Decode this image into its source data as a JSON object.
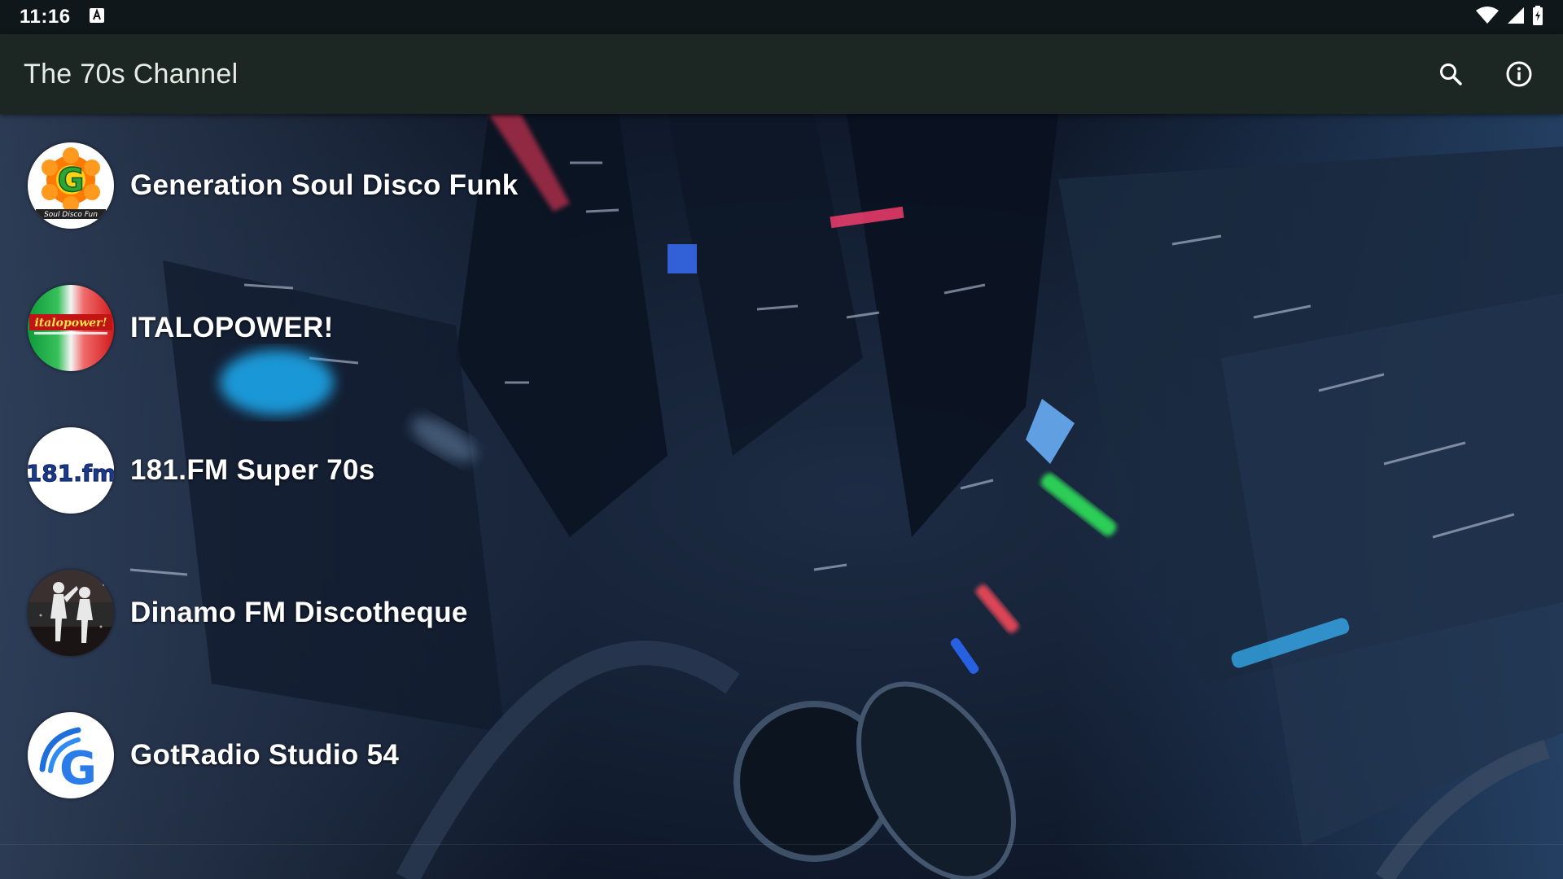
{
  "status_bar": {
    "time": "11:16",
    "notification_icon": "keyboard-a-icon",
    "icons": [
      "wifi-icon",
      "cell-signal-icon",
      "battery-icon"
    ]
  },
  "app_bar": {
    "title": "The 70s Channel",
    "actions": [
      "search-icon",
      "info-icon"
    ]
  },
  "stations": [
    {
      "name": "Generation Soul Disco Funk",
      "logo": "generation-soul-logo"
    },
    {
      "name": "ITALOPOWER!",
      "logo": "italopower-logo"
    },
    {
      "name": "181.FM Super 70s",
      "logo": "181fm-logo"
    },
    {
      "name": "Dinamo FM Discotheque",
      "logo": "dinamo-fm-logo"
    },
    {
      "name": "GotRadio Studio 54",
      "logo": "gotradio-logo"
    }
  ],
  "logo_text": {
    "generation_soul_letter": "G",
    "generation_soul_caption": "Soul Disco Fun",
    "italopower": "italopower!",
    "fm181": "181.fm",
    "gotradio_letter": "G"
  },
  "colors": {
    "status_bar_bg": "#10171a",
    "app_bar_bg": "#1c2622",
    "text": "#ffffff",
    "accent_green": "#2fe05a",
    "accent_blue": "#1fb6ff"
  }
}
